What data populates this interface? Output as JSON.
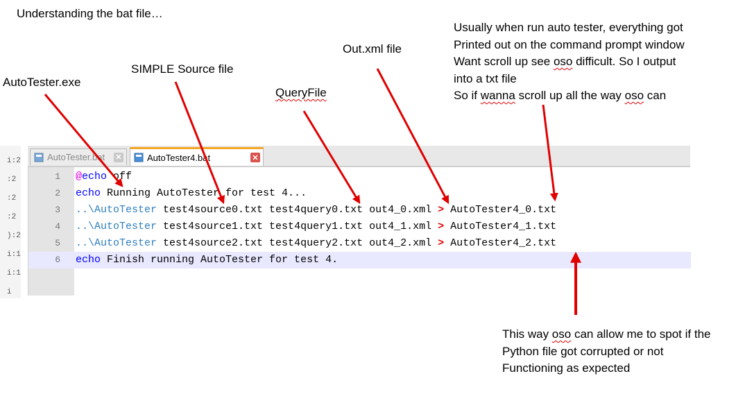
{
  "annotations": {
    "title": "Understanding the bat file…",
    "autotester_exe": "AutoTester.exe",
    "simple_source": "SIMPLE Source file",
    "query_file": "QueryFile",
    "out_xml": "Out.xml file",
    "txt_note": {
      "line1": "Usually when run auto tester, everything got",
      "line2": "Printed out on the command prompt window",
      "line3_a": "Want scroll up see ",
      "line3_oso": "oso",
      "line3_b": " difficult. So I output",
      "line4": "into a txt file",
      "line5_a": "So if ",
      "line5_wanna": "wanna",
      "line5_b": " scroll up all the way ",
      "line5_oso": "oso",
      "line5_c": " can"
    },
    "bottom_note": {
      "line1_a": "This way ",
      "line1_oso": "oso",
      "line1_b": " can allow me to spot if the",
      "line2": "Python file got corrupted or not",
      "line3": "Functioning as expected"
    },
    "arrow_color": "#e00000"
  },
  "strip_labels": [
    "i:2",
    ":2",
    ":2",
    ":2",
    "):2",
    "i:1",
    "i:1",
    "i"
  ],
  "tabs": [
    {
      "label": "AutoTester.bat",
      "active": false
    },
    {
      "label": "AutoTester4.bat",
      "active": true
    }
  ],
  "editor": {
    "lines": [
      {
        "num": "1",
        "at": "@",
        "kw": "echo",
        "rest": " off"
      },
      {
        "num": "2",
        "kw": "echo",
        "rest": " Running AutoTester for test 4..."
      },
      {
        "num": "3",
        "path": "..\\AutoTester",
        "rest": " test4source0.txt test4query0.txt out4_0.xml ",
        "redir": ">",
        "tail": " AutoTester4_0.txt"
      },
      {
        "num": "4",
        "path": "..\\AutoTester",
        "rest": " test4source1.txt test4query1.txt out4_1.xml ",
        "redir": ">",
        "tail": " AutoTester4_1.txt"
      },
      {
        "num": "5",
        "path": "..\\AutoTester",
        "rest": " test4source2.txt test4query2.txt out4_2.xml ",
        "redir": ">",
        "tail": " AutoTester4_2.txt"
      },
      {
        "num": "6",
        "kw": "echo",
        "rest": " Finish running AutoTester for test 4."
      }
    ],
    "current_line": "6",
    "current_line_color": "#e8e8ff",
    "keyword_color": "#0000ff",
    "path_color": "#2f7fbf"
  }
}
